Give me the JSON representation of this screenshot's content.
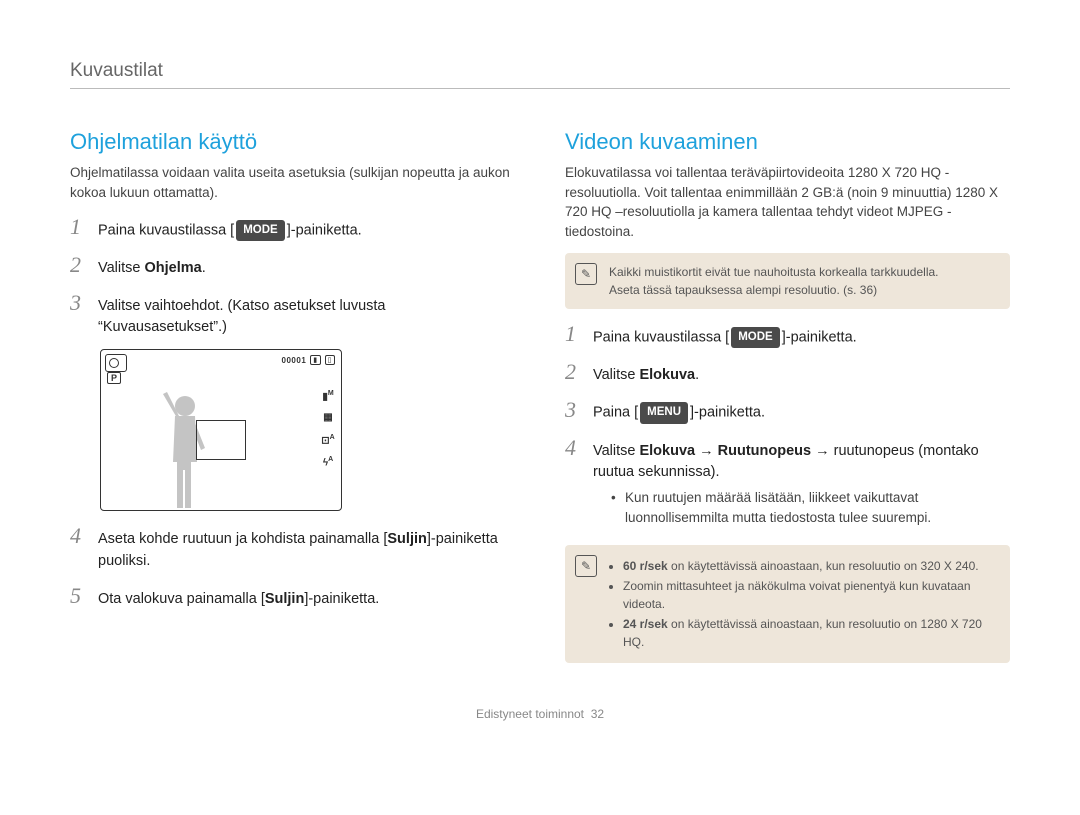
{
  "header": "Kuvaustilat",
  "left": {
    "title": "Ohjelmatilan käyttö",
    "intro": "Ohjelmatilassa voidaan valita useita asetuksia (sulkijan nopeutta ja aukon kokoa lukuun ottamatta).",
    "steps": {
      "s1a": "Paina kuvaustilassa [",
      "s1chip": "MODE",
      "s1b": "]-painiketta.",
      "s2a": "Valitse ",
      "s2b": "Ohjelma",
      "s2c": ".",
      "s3": "Valitse vaihtoehdot. (Katso asetukset luvusta “Kuvausasetukset”.)",
      "s4a": "Aseta kohde ruutuun ja kohdista painamalla [",
      "s4b": "Suljin",
      "s4c": "]-painiketta puoliksi.",
      "s5a": "Ota valokuva painamalla [",
      "s5b": "Suljin",
      "s5c": "]-painiketta."
    },
    "preview": {
      "count": "00001",
      "p_label": "P",
      "right_icons": [
        "M",
        "▦",
        "A",
        "A"
      ]
    }
  },
  "right": {
    "title": "Videon kuvaaminen",
    "intro": "Elokuvatilassa voi tallentaa teräväpiirtovideoita 1280 X 720 HQ -resoluutiolla. Voit tallentaa enimmillään 2 GB:ä (noin 9 minuuttia) 1280 X 720 HQ –resoluutiolla ja kamera tallentaa tehdyt videot MJPEG -tiedostoina.",
    "note1_line1": "Kaikki muistikortit eivät tue nauhoitusta korkealla tarkkuudella.",
    "note1_line2": "Aseta tässä tapauksessa alempi resoluutio. (s. 36)",
    "steps": {
      "s1a": "Paina kuvaustilassa [",
      "s1chip": "MODE",
      "s1b": "]-painiketta.",
      "s2a": "Valitse ",
      "s2b": "Elokuva",
      "s2c": ".",
      "s3a": "Paina [",
      "s3chip": "MENU",
      "s3b": "]-painiketta.",
      "s4a": "Valitse ",
      "s4b": "Elokuva",
      "s4arrow": " → ",
      "s4c": "Ruutunopeus",
      "s4d": " → ruutunopeus (montako ruutua sekunnissa).",
      "s4bullet": "Kun ruutujen määrää lisätään, liikkeet vaikuttavat luonnollisemmilta mutta tiedostosta tulee suurempi."
    },
    "note2": {
      "b1a": "60 r/sek",
      "b1b": " on käytettävissä ainoastaan, kun resoluutio on 320 X 240.",
      "b2": "Zoomin mittasuhteet ja näkökulma voivat pienentyä kun kuvataan videota.",
      "b3a": "24 r/sek",
      "b3b": " on käytettävissä ainoastaan, kun resoluutio on 1280 X 720 HQ."
    }
  },
  "footer_label": "Edistyneet toiminnot",
  "footer_page": "32"
}
